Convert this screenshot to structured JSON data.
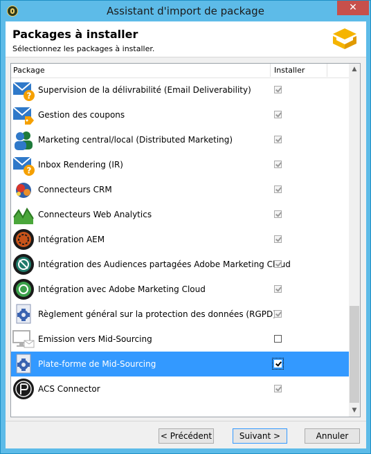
{
  "window": {
    "title": "Assistant d'import de package",
    "close_label": "✕"
  },
  "header": {
    "title": "Packages à installer",
    "subtitle": "Sélectionnez les packages à installer."
  },
  "list": {
    "columns": {
      "package": "Package",
      "installer": "Installer"
    },
    "rows": [
      {
        "label": "Supervision de la délivrabilité (Email Deliverability)",
        "icon": "email-question-icon",
        "checked": true,
        "selected": false
      },
      {
        "label": "Gestion des coupons",
        "icon": "email-coupon-icon",
        "checked": true,
        "selected": false
      },
      {
        "label": "Marketing central/local (Distributed Marketing)",
        "icon": "users-icon",
        "checked": true,
        "selected": false
      },
      {
        "label": "Inbox Rendering (IR)",
        "icon": "email-question-icon",
        "checked": true,
        "selected": false
      },
      {
        "label": "Connecteurs CRM",
        "icon": "crm-connector-icon",
        "checked": true,
        "selected": false
      },
      {
        "label": "Connecteurs Web Analytics",
        "icon": "web-analytics-icon",
        "checked": true,
        "selected": false
      },
      {
        "label": "Intégration AEM",
        "icon": "aem-icon",
        "checked": true,
        "selected": false
      },
      {
        "label": "Intégration des Audiences partagées Adobe Marketing Cloud",
        "icon": "audiences-icon",
        "checked": true,
        "selected": false
      },
      {
        "label": "Intégration avec Adobe Marketing Cloud",
        "icon": "marketing-cloud-icon",
        "checked": true,
        "selected": false
      },
      {
        "label": "Règlement général sur la protection des données (RGPD)",
        "icon": "gear-document-icon",
        "checked": true,
        "selected": false
      },
      {
        "label": "Emission vers Mid-Sourcing",
        "icon": "monitor-email-icon",
        "checked": false,
        "selected": false
      },
      {
        "label": "Plate-forme de Mid-Sourcing",
        "icon": "gear-document-icon",
        "checked": true,
        "selected": true
      },
      {
        "label": "ACS Connector",
        "icon": "acs-connector-icon",
        "checked": true,
        "selected": false
      }
    ]
  },
  "buttons": {
    "previous": "< Précédent",
    "next": "Suivant >",
    "cancel": "Annuler"
  },
  "colors": {
    "selection": "#3399ff",
    "titlebar": "#5dbbe8",
    "close": "#c7504b"
  }
}
